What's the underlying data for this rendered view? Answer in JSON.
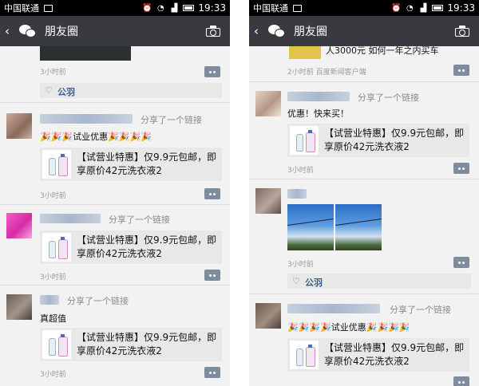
{
  "colors": {
    "status_bar": "#000000",
    "nav_bar": "#393a3f",
    "feed_bg": "#f2f2f2",
    "link_name": "#3a5a8c",
    "comment_button": "#7f8c9d"
  },
  "left_screen": {
    "status": {
      "carrier": "中国联通",
      "time": "19:33"
    },
    "nav": {
      "title": "朋友圈",
      "back_icon": "‹",
      "camera_icon": "camera-icon"
    },
    "top_post": {
      "time": "3小时前",
      "liker": "公羽"
    },
    "posts": [
      {
        "action": "分享了一个链接",
        "emoji_text": "试业优惠",
        "card_title": "【试营业特惠】仅9.9元包邮，即享原价42元洗衣液2",
        "time": "3小时前"
      },
      {
        "action": "分享了一个链接",
        "card_title": "【试营业特惠】仅9.9元包邮，即享原价42元洗衣液2",
        "time": "3小时前"
      },
      {
        "action": "分享了一个链接",
        "text": "真超值",
        "card_title": "【试营业特惠】仅9.9元包邮，即享原价42元洗衣液2",
        "time": "3小时前"
      }
    ]
  },
  "right_screen": {
    "status": {
      "carrier": "中国联通",
      "time": "19:33"
    },
    "nav": {
      "title": "朋友圈"
    },
    "top_post": {
      "banner_text": "人3000元 如何一年之内买车",
      "time": "2小时前",
      "source": "百度新闻客户端"
    },
    "posts": [
      {
        "action": "分享了一个链接",
        "text": "优惠！快来买！",
        "card_title": "【试营业特惠】仅9.9元包邮，即享原价42元洗衣液2",
        "time": "3小时前"
      },
      {
        "time": "3小时前",
        "liker": "公羽"
      },
      {
        "action": "分享了一个链接",
        "emoji_text": "试业优惠",
        "card_title": "【试营业特惠】仅9.9元包邮，即享原价42元洗衣液2"
      }
    ]
  }
}
